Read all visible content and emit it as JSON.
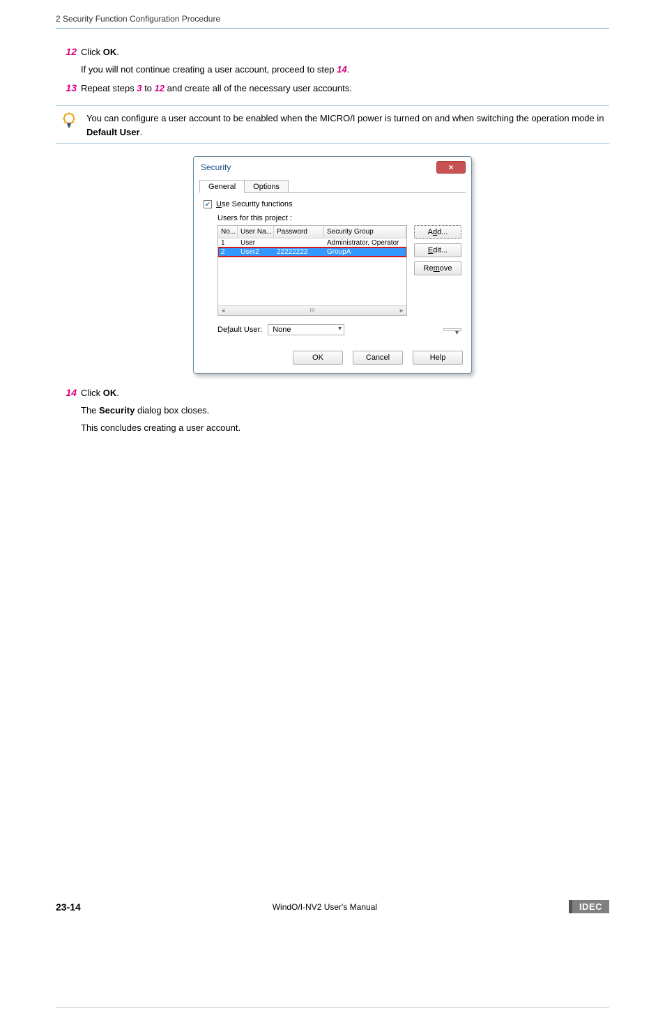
{
  "header": {
    "section": "2 Security Function Configuration Procedure"
  },
  "steps": {
    "s12": {
      "num": "12",
      "main_pre": "Click ",
      "main_bold": "OK",
      "main_post": ".",
      "sub_pre": "If you will not continue creating a user account, proceed to step ",
      "sub_link": "14",
      "sub_post": "."
    },
    "s13": {
      "num": "13",
      "pre": "Repeat steps ",
      "link1": "3",
      "mid": " to ",
      "link2": "12",
      "post": " and create all of the necessary user accounts."
    },
    "s14": {
      "num": "14",
      "main_pre": "Click ",
      "main_bold": "OK",
      "main_post": ".",
      "sub1_pre": "The ",
      "sub1_bold": "Security",
      "sub1_post": " dialog box closes.",
      "sub2": "This concludes creating a user account."
    }
  },
  "tip": {
    "text_pre": "You can configure a user account to be enabled when the MICRO/I power is turned on and when switching the operation mode in ",
    "text_bold": "Default User",
    "text_post": "."
  },
  "dialog": {
    "title": "Security",
    "close": "×",
    "tabs": {
      "general": "General",
      "options": "Options"
    },
    "use_security_pre": "U",
    "use_security_label": "se Security functions",
    "users_label": "Users for this project :",
    "columns": {
      "no": "No...",
      "user": "User Na...",
      "pass": "Password",
      "grp": "Security Group"
    },
    "rows": [
      {
        "no": "1",
        "user": "User",
        "pass": "",
        "grp": "Administrator, Operator"
      },
      {
        "no": "2",
        "user": "User2",
        "pass": "22222222",
        "grp": "GroupA"
      }
    ],
    "scroll_mid": "III",
    "btns": {
      "add_pre": "A",
      "add_accel": "d",
      "add_post": "d...",
      "edit_accel": "E",
      "edit_post": "dit...",
      "remove_pre": "Re",
      "remove_accel": "m",
      "remove_post": "ove"
    },
    "default_label_pre": "De",
    "default_label_accel": "f",
    "default_label_post": "ault User:",
    "default_value": "None",
    "footer": {
      "ok": "OK",
      "cancel": "Cancel",
      "help": "Help"
    }
  },
  "footer": {
    "page": "23-14",
    "manual": "WindO/I-NV2 User's Manual",
    "brand": "IDEC"
  }
}
